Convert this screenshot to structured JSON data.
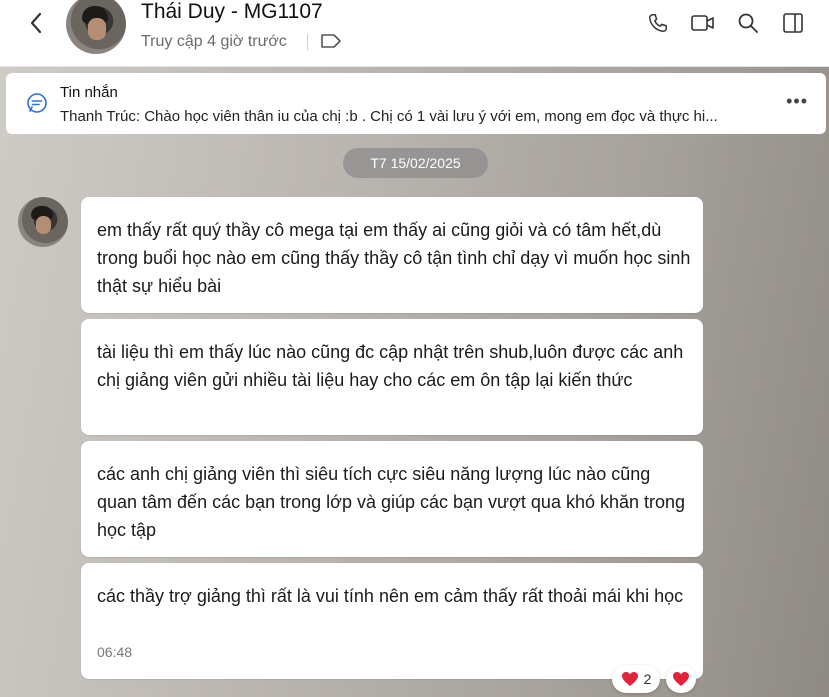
{
  "header": {
    "contact_name": "Thái Duy - MG1107",
    "status": "Truy cập 4 giờ trước",
    "icons": [
      "back-icon",
      "tag-icon",
      "phone-icon",
      "video-icon",
      "search-icon",
      "sidebar-toggle-icon"
    ]
  },
  "pinned": {
    "title": "Tin nhắn",
    "preview": "Thanh Trúc: Chào học viên thân iu của chị :b . Chị có 1 vài lưu ý với em, mong em đọc và thực hi..."
  },
  "date_divider": "T7 15/02/2025",
  "messages": [
    {
      "text": "em thấy rất quý thầy cô mega tại em thấy ai cũng giỏi và có tâm hết,dù trong buổi học nào em cũng thấy thầy cô tận tình chỉ dạy vì muốn học sinh thật sự hiểu bài"
    },
    {
      "text": "tài liệu thì em thấy lúc nào cũng đc cập nhật trên shub,luôn được các anh chị giảng viên gửi nhiều tài liệu hay cho các em ôn tập lại kiến thức"
    },
    {
      "text": "các anh chị giảng viên thì siêu tích cực siêu năng lượng lúc nào cũng quan tâm đến các bạn trong lớp và giúp các bạn vượt qua khó khăn trong học tập"
    },
    {
      "text": "các thầy trợ giảng thì rất là vui tính nên em cảm thấy rất thoải mái khi học",
      "time": "06:48"
    }
  ],
  "reactions": {
    "heart_count": "2",
    "accent": "#e0243a"
  }
}
